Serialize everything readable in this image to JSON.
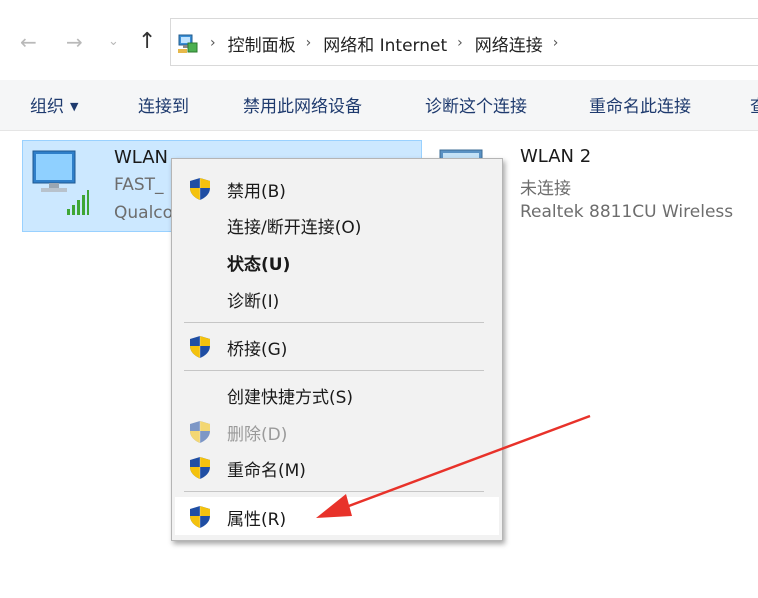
{
  "breadcrumb": [
    "控制面板",
    "网络和 Internet",
    "网络连接"
  ],
  "commands": {
    "organize": "组织",
    "connect_to": "连接到",
    "disable_device": "禁用此网络设备",
    "diagnose": "诊断这个连接",
    "rename": "重命名此连接",
    "more": "查"
  },
  "items": {
    "wlan": {
      "name": "WLAN",
      "network": "FAST_",
      "adapter": "Qualco"
    },
    "wlan2": {
      "name": "WLAN 2",
      "status": "未连接",
      "adapter": "Realtek 8811CU Wireless"
    }
  },
  "context_menu": {
    "disable": "禁用(B)",
    "connect_disconnect": "连接/断开连接(O)",
    "status": "状态(U)",
    "diagnose": "诊断(I)",
    "bridge": "桥接(G)",
    "create_shortcut": "创建快捷方式(S)",
    "delete": "删除(D)",
    "rename": "重命名(M)",
    "properties": "属性(R)"
  },
  "colors": {
    "selection": "#cce8ff",
    "annotation_arrow": "#e8322a",
    "command_text": "#1e3a6e"
  }
}
